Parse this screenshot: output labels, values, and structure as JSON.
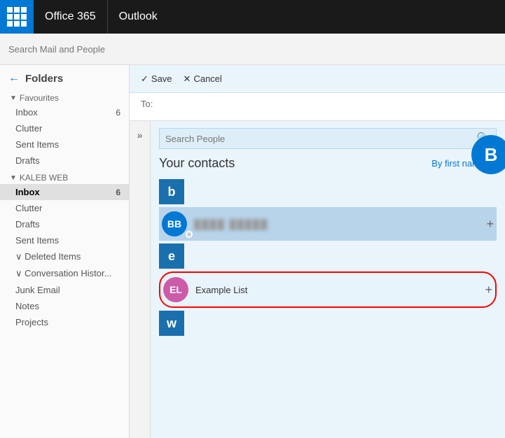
{
  "topbar": {
    "office_label": "Office 365",
    "app_label": "Outlook"
  },
  "search": {
    "placeholder": "Search Mail and People"
  },
  "sidebar": {
    "folders_label": "Folders",
    "groups": [
      {
        "name": "Favourites",
        "expanded": true,
        "items": [
          {
            "label": "Inbox",
            "badge": "6",
            "active": false
          },
          {
            "label": "Clutter",
            "badge": "",
            "active": false
          },
          {
            "label": "Sent Items",
            "badge": "",
            "active": false
          },
          {
            "label": "Drafts",
            "badge": "",
            "active": false
          }
        ]
      },
      {
        "name": "KALEB WEB",
        "expanded": true,
        "items": [
          {
            "label": "Inbox",
            "badge": "6",
            "active": true
          },
          {
            "label": "Clutter",
            "badge": "",
            "active": false
          },
          {
            "label": "Drafts",
            "badge": "",
            "active": false
          },
          {
            "label": "Sent Items",
            "badge": "",
            "active": false
          },
          {
            "label": "Deleted Items",
            "badge": "",
            "active": false
          },
          {
            "label": "Conversation Histor...",
            "badge": "",
            "active": false
          },
          {
            "label": "Junk Email",
            "badge": "",
            "active": false
          },
          {
            "label": "Notes",
            "badge": "",
            "active": false
          },
          {
            "label": "Projects",
            "badge": "",
            "active": false
          }
        ]
      }
    ]
  },
  "toolbar": {
    "save_label": "Save",
    "cancel_label": "Cancel"
  },
  "compose": {
    "to_label": "To:"
  },
  "people_panel": {
    "search_placeholder": "Search People",
    "contacts_title": "Your contacts",
    "sort_label": "By first name",
    "contacts": [
      {
        "letter_header": "b",
        "letter_bg": "#1a6fad"
      },
      {
        "initials": "BB",
        "name": "████ █████",
        "blurred": true,
        "bg_color": "#0078d4",
        "has_add": true
      },
      {
        "letter_header": "e",
        "letter_bg": "#1a6fad"
      },
      {
        "initials": "EL",
        "name": "Example List",
        "blurred": false,
        "bg_color": "#cc5ba8",
        "has_add": true,
        "circled": true
      },
      {
        "letter_header": "w",
        "letter_bg": "#1a6fad"
      }
    ],
    "big_avatar": "B",
    "big_avatar_bg": "#0078d4"
  }
}
